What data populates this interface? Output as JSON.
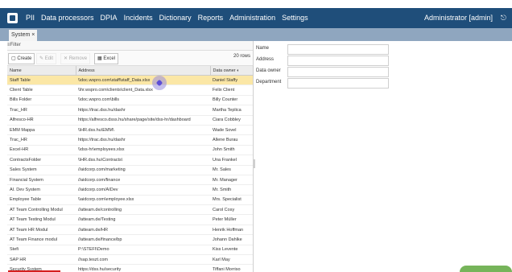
{
  "topbar": {
    "menu": [
      "PII",
      "Data processors",
      "DPIA",
      "Incidents",
      "Dictionary",
      "Reports",
      "Administration",
      "Settings"
    ],
    "user": "Administrator [admin]"
  },
  "tabs": [
    {
      "label": "System ×"
    }
  ],
  "left": {
    "filter_label": "≡Filter",
    "toolbar": {
      "create": "Create",
      "edit": "Edit",
      "remove": "Remove",
      "excel": "Excel",
      "rows": "20 rows"
    },
    "columns": [
      "Name",
      "Address",
      "Data owner"
    ],
    "rows": [
      {
        "name": "Staff Table",
        "address": "\\\\doc.wspro.com\\staff\\staff_Data.xlsx",
        "owner": "Daniel Staffy",
        "selected": true
      },
      {
        "name": "Client Table",
        "address": "\\\\hr.wspro.com\\clients\\client_Data.xlsx",
        "owner": "Felix Client"
      },
      {
        "name": "Bills Folder",
        "address": "\\\\doc.wspro.com\\bills",
        "owner": "Billy Counter"
      },
      {
        "name": "Trac_HR",
        "address": "https://trac.dss.hu/dashr",
        "owner": "Martha Teplica"
      },
      {
        "name": "Alfresco-HR",
        "address": "https://alfresco.dsss.hu/share/page/site/dss-hr/dashboard",
        "owner": "Ciara Cobbley"
      },
      {
        "name": "EMM Mappa",
        "address": "\\\\HR.dss.hu\\EMM\\",
        "owner": "Wade Sovel"
      },
      {
        "name": "Trac_HR",
        "address": "https://trac.dss.hu/dashr",
        "owner": "Allene Burau"
      },
      {
        "name": "Excel-HR",
        "address": "\\\\dss-hr\\employees.xlsx",
        "owner": "John Smith"
      },
      {
        "name": "ContractsFolder",
        "address": "\\\\HR.dss.hu\\Contracts\\",
        "owner": "Una Frankel"
      },
      {
        "name": "Sales System",
        "address": "//aidcorp.com/marketing",
        "owner": "Mr. Sales"
      },
      {
        "name": "Financial System",
        "address": "//aidcorp.com/finance",
        "owner": "Mr. Manager"
      },
      {
        "name": "AI. Dev System",
        "address": "//aidcorp.com/AIDev",
        "owner": "Mr. Smith"
      },
      {
        "name": "Employee Table",
        "address": "\\\\aidcorp.com\\employee.xlsx",
        "owner": "Mrs. Specialist"
      },
      {
        "name": "AT Team Controlling Modul",
        "address": "//atteam.de/controlling",
        "owner": "Carol Cosy"
      },
      {
        "name": "AT Team Testing Modul",
        "address": "//atteam.de/Testing",
        "owner": "Peter Müller"
      },
      {
        "name": "AT Team HR Modul",
        "address": "//atteam.de/HR",
        "owner": "Henrik Hoffman"
      },
      {
        "name": "AT Team Finance modul",
        "address": "//atteam.de/finance/bp",
        "owner": "Johann Dahlke"
      },
      {
        "name": "Stefi",
        "address": "P:\\STEFI\\Demo",
        "owner": "Kiss Levente"
      },
      {
        "name": "SAP HR",
        "address": "//sap.teszt.com",
        "owner": "Karl May"
      },
      {
        "name": "Security System",
        "address": "https://dss.hu/security",
        "owner": "Tiffani Morriso"
      }
    ]
  },
  "details": {
    "labels": [
      "Name",
      "Address",
      "Data owner",
      "Department"
    ],
    "values": [
      "",
      "",
      "",
      ""
    ]
  },
  "colors": {
    "topbar": "#1f4e7a",
    "tabbar": "#8fa6bf",
    "selected_row": "#fbe7a6"
  },
  "icons": [
    "app-logo-icon",
    "logout-icon",
    "table-sort-icon",
    "filter-icon",
    "create-icon",
    "edit-icon",
    "remove-icon",
    "excel-icon"
  ]
}
